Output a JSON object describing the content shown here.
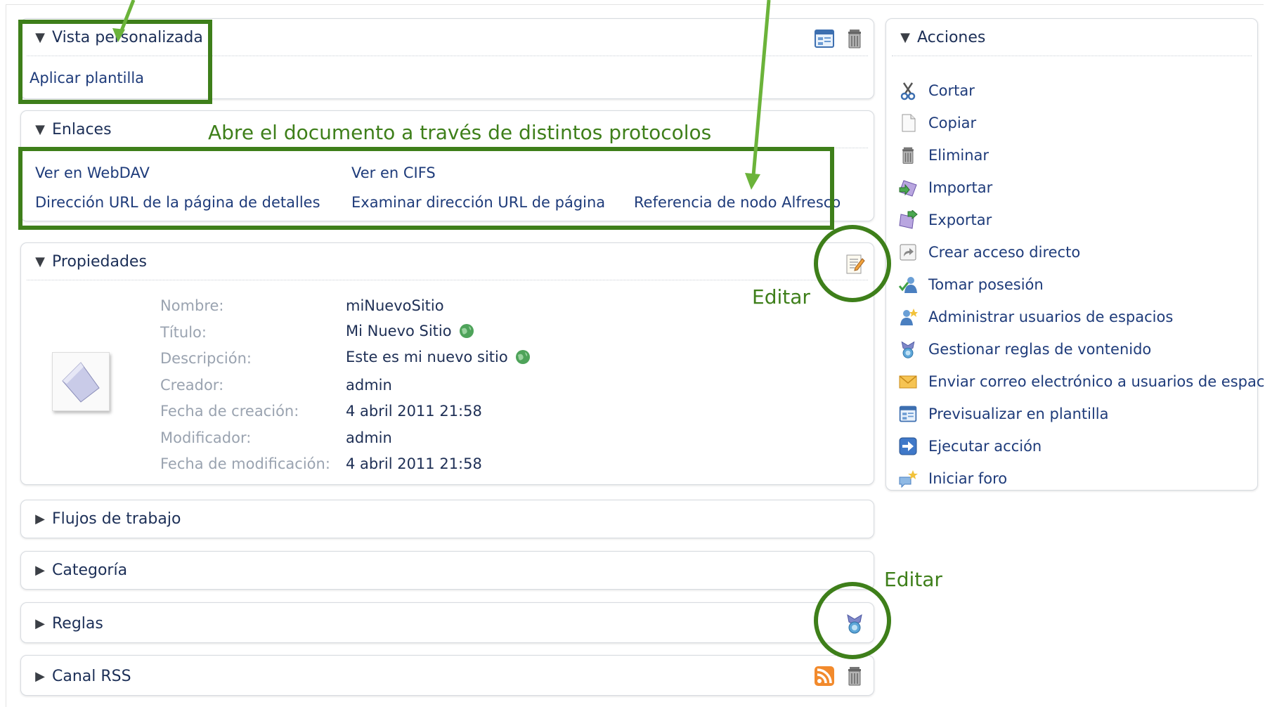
{
  "panels": {
    "vista": {
      "title": "Vista personalizada",
      "apply_template": "Aplicar plantilla"
    },
    "enlaces": {
      "title": "Enlaces",
      "links": [
        "Ver en WebDAV",
        "Ver en CIFS",
        "Dirección URL de la página de detalles",
        "Examinar dirección URL de página",
        "Referencia de nodo Alfresco"
      ]
    },
    "propiedades": {
      "title": "Propiedades",
      "labels": [
        "Nombre:",
        "Título:",
        "Descripción:",
        "Creador:",
        "Fecha de creación:",
        "Modificador:",
        "Fecha de modificación:"
      ],
      "values": [
        "miNuevoSitio",
        "Mi Nuevo Sitio",
        "Este es mi nuevo sitio",
        "admin",
        "4 abril 2011 21:58",
        "admin",
        "4 abril 2011 21:58"
      ]
    },
    "flujos": {
      "title": "Flujos de trabajo"
    },
    "categoria": {
      "title": "Categoría"
    },
    "reglas": {
      "title": "Reglas"
    },
    "rss": {
      "title": "Canal RSS"
    }
  },
  "actions": {
    "title": "Acciones",
    "items": [
      {
        "label": "Cortar",
        "icon": "scissors-icon"
      },
      {
        "label": "Copiar",
        "icon": "copy-icon"
      },
      {
        "label": "Eliminar",
        "icon": "trash-icon"
      },
      {
        "label": "Importar",
        "icon": "import-icon"
      },
      {
        "label": "Exportar",
        "icon": "export-icon"
      },
      {
        "label": "Crear acceso directo",
        "icon": "shortcut-icon"
      },
      {
        "label": "Tomar posesión",
        "icon": "take-ownership-icon"
      },
      {
        "label": "Administrar usuarios de espacios",
        "icon": "manage-users-icon"
      },
      {
        "label": "Gestionar reglas de vontenido",
        "icon": "rules-icon"
      },
      {
        "label": "Enviar correo electrónico a usuarios de espacio",
        "icon": "email-icon"
      },
      {
        "label": "Previsualizar en plantilla",
        "icon": "preview-template-icon"
      },
      {
        "label": "Ejecutar acción",
        "icon": "run-action-icon"
      },
      {
        "label": "Iniciar foro",
        "icon": "forum-icon"
      }
    ]
  },
  "annotations": {
    "protocols": "Abre el documento a través de distintos protocolos",
    "edit_props": "Editar",
    "edit_rules": "Editar"
  },
  "colors": {
    "annotation_green": "#3e7f1a",
    "link_blue": "#1e3b7a"
  }
}
